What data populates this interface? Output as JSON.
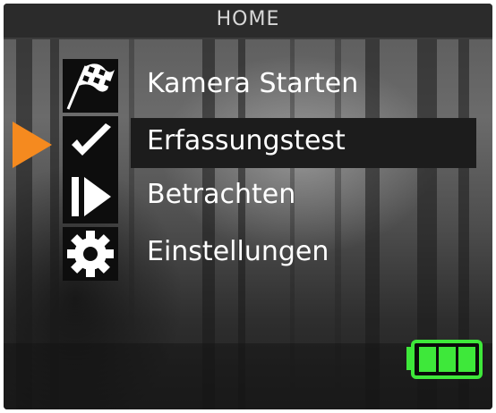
{
  "header": {
    "title": "HOME"
  },
  "menu": {
    "items": [
      {
        "label": "Kamera Starten",
        "icon": "checkered-flag-icon"
      },
      {
        "label": "Erfassungstest",
        "icon": "checkmark-icon",
        "selected": true
      },
      {
        "label": "Betrachten",
        "icon": "play-icon"
      },
      {
        "label": "Einstellungen",
        "icon": "gear-icon"
      }
    ]
  },
  "status": {
    "battery_level": 1.0,
    "battery_color": "#3ee83a"
  },
  "colors": {
    "cursor": "#f58a1f",
    "title_bar": "#2b2b2b",
    "menu_text": "#ffffff"
  }
}
